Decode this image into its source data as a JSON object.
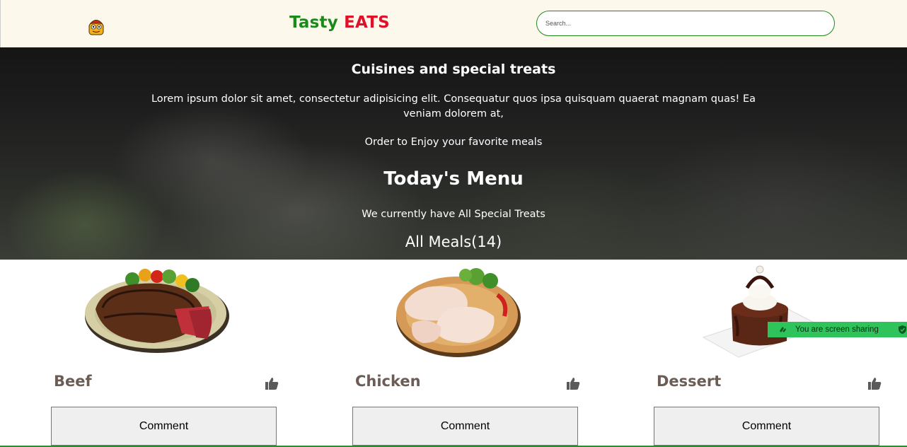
{
  "header": {
    "brand_part1": "Tasty",
    "brand_part2": "EATS",
    "search_placeholder": "Search...",
    "logo_icon": "mascot-logo-icon"
  },
  "hero": {
    "title": "Cuisines and special treats",
    "description": "Lorem ipsum dolor sit amet, consectetur adipisicing elit. Consequatur quos ipsa quisquam quaerat magnam quas! Ea veniam dolorem at,",
    "order_text": "Order to Enjoy your favorite meals",
    "menu_title": "Today's Menu",
    "subtitle": "We currently have All Special Treats",
    "meals_count": "All Meals(14)"
  },
  "meals": [
    {
      "name": "Beef",
      "comment_label": "Comment",
      "image_icon": "beef-steak-image"
    },
    {
      "name": "Chicken",
      "comment_label": "Comment",
      "image_icon": "chicken-image"
    },
    {
      "name": "Dessert",
      "comment_label": "Comment",
      "image_icon": "dessert-image"
    }
  ],
  "screen_share": {
    "label": "You are screen sharing"
  },
  "colors": {
    "brand_green": "#1a8a1a",
    "brand_red": "#e0102a",
    "header_bg": "#fdf8ec",
    "share_green": "#2fc35b"
  }
}
